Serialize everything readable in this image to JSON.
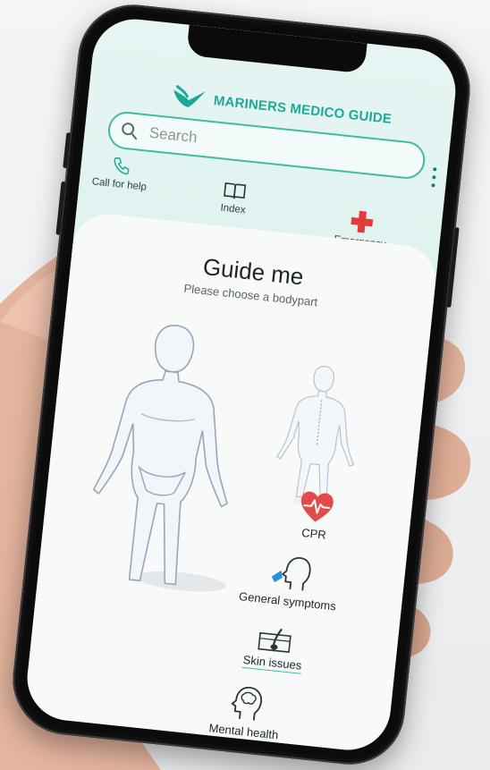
{
  "app": {
    "brand_name": "MARINERS MEDICO GUIDE",
    "accent_color": "#1fa897"
  },
  "search": {
    "placeholder": "Search",
    "icon": "search-icon"
  },
  "quick_actions": [
    {
      "label": "Call for help",
      "icon": "phone-icon"
    },
    {
      "label": "Index",
      "icon": "book-icon"
    },
    {
      "label": "Emergency",
      "icon": "red-cross-icon",
      "color": "#e23b3b"
    }
  ],
  "main": {
    "title": "Guide me",
    "subtitle": "Please choose a bodypart",
    "categories": [
      {
        "label": "CPR",
        "icon": "heart-pulse-icon",
        "color": "#e34b4b"
      },
      {
        "label": "General symptoms",
        "icon": "head-profile-icon"
      },
      {
        "label": "Skin issues",
        "icon": "skin-layer-icon"
      },
      {
        "label": "Mental health",
        "icon": "brain-head-icon"
      }
    ]
  }
}
